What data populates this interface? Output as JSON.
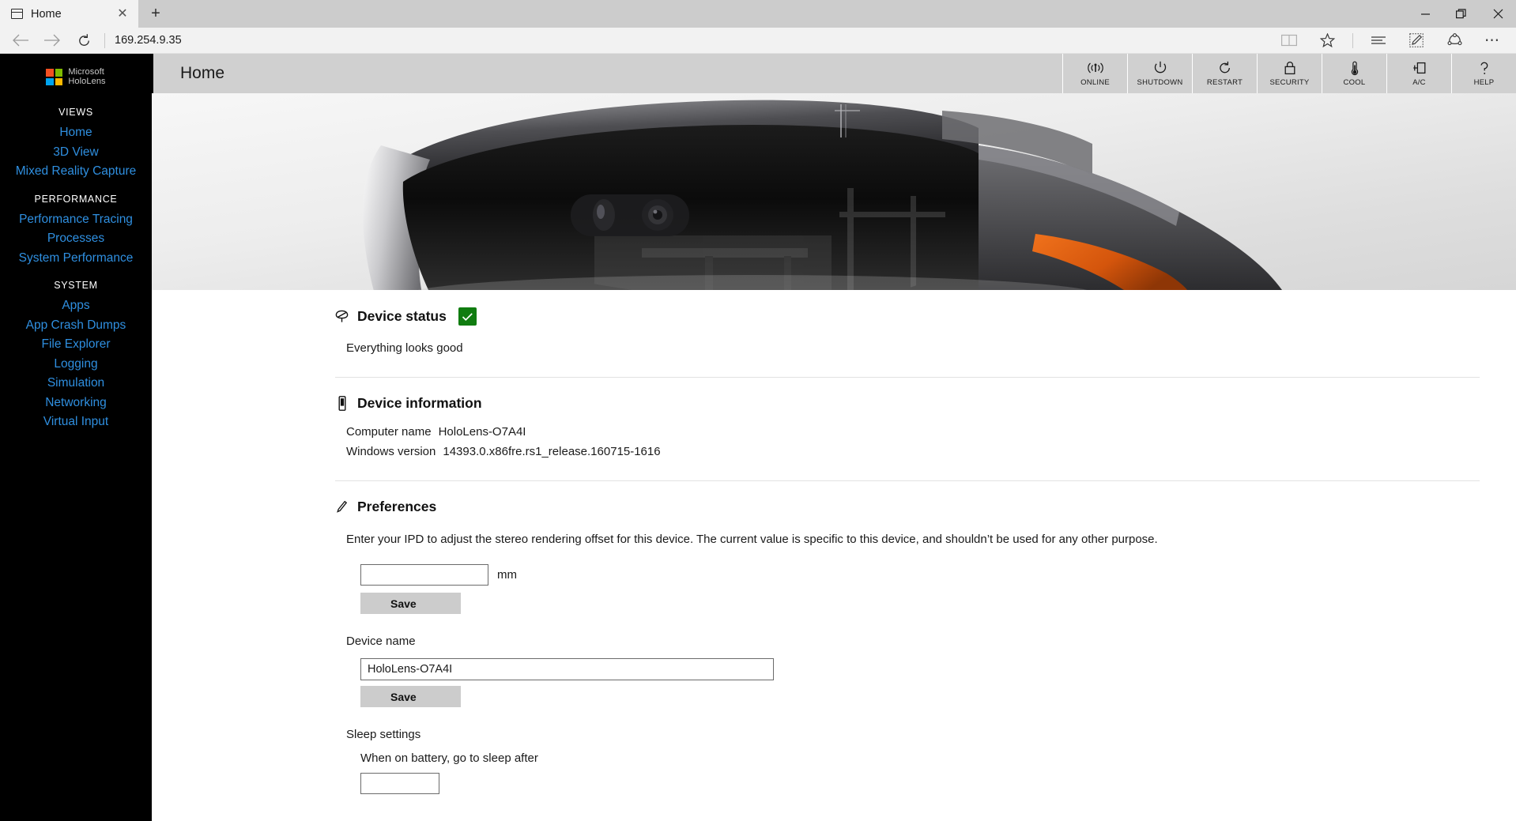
{
  "browser": {
    "tab": {
      "title": "Home",
      "favicon": "window-icon",
      "close": "✕"
    },
    "new_tab": "+",
    "window_controls": {
      "minimize": "minimize-icon",
      "maximize": "maximize-icon",
      "close": "close-icon"
    },
    "nav": {
      "back": "back-arrow-icon",
      "forward": "forward-arrow-icon",
      "refresh": "refresh-icon",
      "url": "169.254.9.35",
      "reading_view": "book-icon",
      "favorites": "star-icon",
      "hub": "hub-lines-icon",
      "web_note": "pen-note-icon",
      "share": "share-icon",
      "more": "⋯"
    }
  },
  "sidebar": {
    "brand": {
      "line1": "Microsoft",
      "line2": "HoloLens"
    },
    "logo_colors": [
      "#f25022",
      "#7fba00",
      "#00a4ef",
      "#ffb900"
    ],
    "link_color": "#2f8fe0",
    "groups": [
      {
        "heading": "VIEWS",
        "items": [
          {
            "label": "Home"
          },
          {
            "label": "3D View"
          },
          {
            "label": "Mixed Reality Capture"
          }
        ]
      },
      {
        "heading": "PERFORMANCE",
        "items": [
          {
            "label": "Performance Tracing"
          },
          {
            "label": "Processes"
          },
          {
            "label": "System Performance"
          }
        ]
      },
      {
        "heading": "SYSTEM",
        "items": [
          {
            "label": "Apps"
          },
          {
            "label": "App Crash Dumps"
          },
          {
            "label": "File Explorer"
          },
          {
            "label": "Logging"
          },
          {
            "label": "Simulation"
          },
          {
            "label": "Networking"
          },
          {
            "label": "Virtual Input"
          }
        ]
      }
    ]
  },
  "app": {
    "title": "Home",
    "toolbar": [
      {
        "label": "ONLINE",
        "icon": "wifi-signal-icon"
      },
      {
        "label": "SHUTDOWN",
        "icon": "power-icon"
      },
      {
        "label": "RESTART",
        "icon": "restart-icon"
      },
      {
        "label": "SECURITY",
        "icon": "lock-icon"
      },
      {
        "label": "COOL",
        "icon": "thermometer-icon"
      },
      {
        "label": "A/C",
        "icon": "power-plug-icon"
      },
      {
        "label": "HELP",
        "icon": "question-mark-icon"
      }
    ]
  },
  "main": {
    "device_status": {
      "title": "Device status",
      "icon": "hololens-device-icon",
      "status_icon": "check-icon",
      "status_color": "#107c10",
      "message": "Everything looks good"
    },
    "device_information": {
      "title": "Device information",
      "icon": "device-info-icon",
      "rows": [
        {
          "key": "Computer name",
          "value": "HoloLens-O7A4I"
        },
        {
          "key": "Windows version",
          "value": "14393.0.x86fre.rs1_release.160715-1616"
        }
      ]
    },
    "preferences": {
      "title": "Preferences",
      "icon": "pencil-icon",
      "ipd_description": "Enter your IPD to adjust the stereo rendering offset for this device. The current value is specific to this device, and shouldn’t be used for any other purpose.",
      "ipd_value": "",
      "ipd_unit": "mm",
      "ipd_save_label": "Save",
      "device_name_label": "Device name",
      "device_name_value": "HoloLens-O7A4I",
      "device_name_save_label": "Save",
      "sleep_settings_label": "Sleep settings",
      "sleep_battery_label": "When on battery, go to sleep after"
    }
  }
}
